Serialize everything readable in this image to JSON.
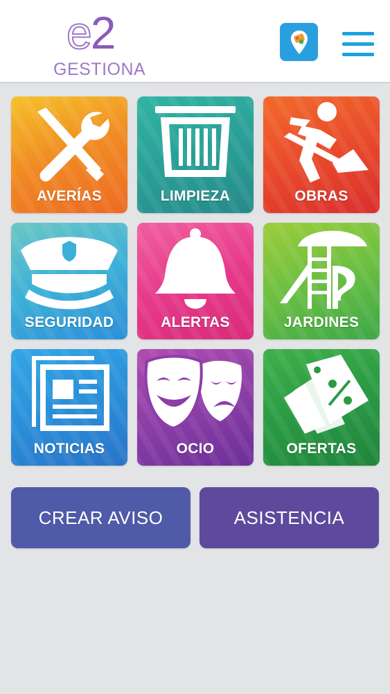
{
  "header": {
    "logo_mark_e": "e",
    "logo_mark_2": "2",
    "logo_subtitle": "GESTIONA",
    "app_badge_icon": "map-pin-shop-icon",
    "menu_icon": "hamburger-menu-icon"
  },
  "tiles": [
    {
      "label": "AVERÍAS",
      "icon": "wrench-screwdriver-icon",
      "colors": [
        "#f5c12a",
        "#f08a23",
        "#ee6a23"
      ]
    },
    {
      "label": "LIMPIEZA",
      "icon": "trash-bin-icon",
      "colors": [
        "#2fb5a2",
        "#2a9f97",
        "#268b88"
      ]
    },
    {
      "label": "OBRAS",
      "icon": "construction-worker-icon",
      "colors": [
        "#f26a2a",
        "#e84a2b",
        "#db2f2e"
      ]
    },
    {
      "label": "SEGURIDAD",
      "icon": "police-cap-icon",
      "colors": [
        "#6cc7c4",
        "#3cb0d8",
        "#2d8fd9"
      ]
    },
    {
      "label": "ALERTAS",
      "icon": "bell-icon",
      "colors": [
        "#f05fa0",
        "#e73a8a",
        "#d92b7a"
      ]
    },
    {
      "label": "JARDINES",
      "icon": "playground-slide-icon",
      "colors": [
        "#9ccc3a",
        "#6bbf42",
        "#3da847"
      ]
    },
    {
      "label": "NOTICIAS",
      "icon": "newspaper-icon",
      "colors": [
        "#33a6e6",
        "#2a8fd9",
        "#2a74c9"
      ]
    },
    {
      "label": "OCIO",
      "icon": "theater-masks-icon",
      "colors": [
        "#b04bb0",
        "#8c3ea7",
        "#6d2f98"
      ]
    },
    {
      "label": "OFERTAS",
      "icon": "price-tag-percent-icon",
      "colors": [
        "#3fb04a",
        "#2a9a43",
        "#1f853d"
      ]
    }
  ],
  "actions": {
    "create_label": "CREAR AVISO",
    "assist_label": "ASISTENCIA",
    "create_color": "#4f5aa8",
    "assist_color": "#5e4a9c"
  }
}
